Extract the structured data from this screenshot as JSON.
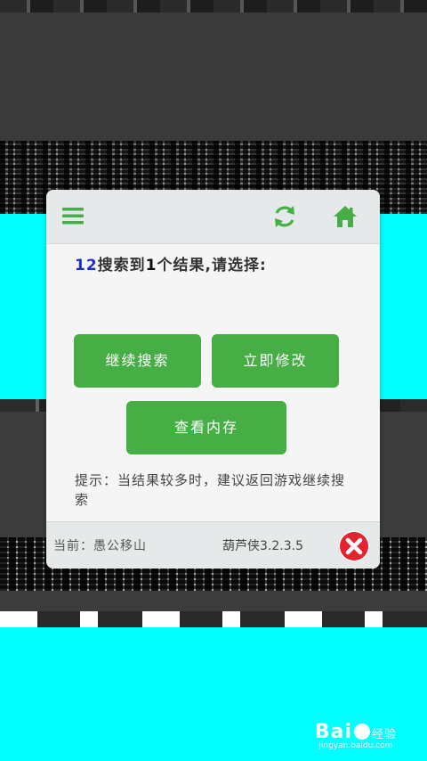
{
  "dialog": {
    "result": {
      "count_searched": "12",
      "text_a": "搜索到",
      "count_found": "1",
      "text_b": "个结果,请选择:"
    },
    "buttons": {
      "continue_label": "继续搜索",
      "modify_label": "立即修改",
      "memory_label": "查看内存"
    },
    "tip": "提示：当结果较多时，建议返回游戏继续搜索",
    "footer": {
      "current": "当前：愚公移山",
      "version": "葫芦侠3.2.3.5"
    }
  },
  "watermark": {
    "main_a": "Bai",
    "main_b": "经验",
    "sub": "jingyan.baidu.com"
  },
  "colors": {
    "accent_green": "#47ad45",
    "number_blue": "#1c2ec9",
    "close_red": "#e52230",
    "background_cyan": "#00ffff"
  },
  "icons": [
    "menu-icon",
    "refresh-icon",
    "home-icon",
    "close-icon"
  ]
}
